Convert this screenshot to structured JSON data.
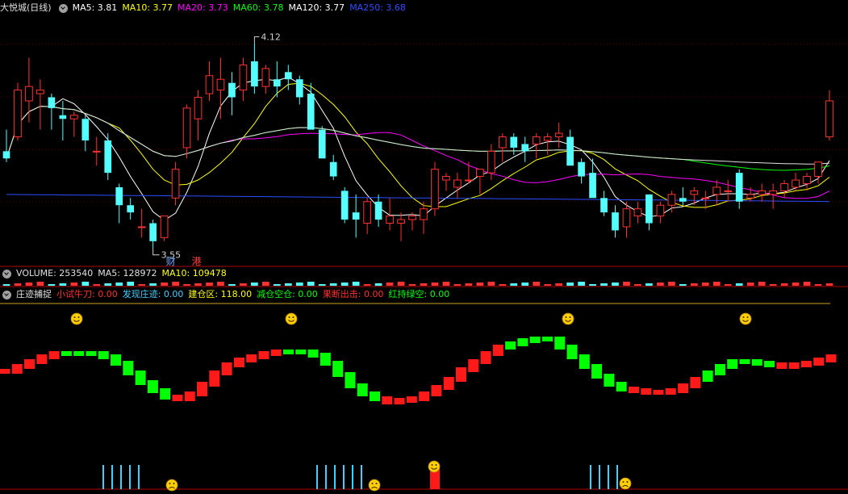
{
  "title_bar": {
    "stock_name": "大悦城(日线)",
    "ma": [
      {
        "label": "MA5: 3.81",
        "color": "#ffffff"
      },
      {
        "label": "MA10: 3.77",
        "color": "#ffff00"
      },
      {
        "label": "MA20: 3.73",
        "color": "#ff00ff"
      },
      {
        "label": "MA60: 3.78",
        "color": "#00ff00"
      },
      {
        "label": "MA120: 3.77",
        "color": "#ffffff"
      },
      {
        "label": "MA250: 3.68",
        "color": "#2d4dff"
      }
    ]
  },
  "price_annotations": {
    "high": "4.12",
    "low": "3.55",
    "badge_cai": "财",
    "badge_gang": "港"
  },
  "volume_bar": {
    "label": "VOLUME: 253540",
    "ma5": "MA5: 128972",
    "ma10": "MA10: 109478"
  },
  "indicator_bar": {
    "name": "庄迹捕捉",
    "items": [
      {
        "label": "小试牛刀: 0.00",
        "color": "#ff3030"
      },
      {
        "label": "发现庄迹: 0.00",
        "color": "#40d0ff"
      },
      {
        "label": "建仓区: 118.00",
        "color": "#ffff00"
      },
      {
        "label": "减仓空仓: 0.00",
        "color": "#00ff00"
      },
      {
        "label": "果断出击: 0.00",
        "color": "#ff3030"
      },
      {
        "label": "红持绿空: 0.00",
        "color": "#00ff00"
      }
    ]
  },
  "chart_data": {
    "type": "candlestick",
    "price_range": [
      3.5,
      4.2
    ],
    "candles": [
      {
        "o": 3.82,
        "h": 3.88,
        "l": 3.79,
        "c": 3.8
      },
      {
        "o": 3.86,
        "h": 4.01,
        "l": 3.85,
        "c": 3.99
      },
      {
        "o": 3.96,
        "h": 4.08,
        "l": 3.9,
        "c": 4.0
      },
      {
        "o": 3.98,
        "h": 4.02,
        "l": 3.88,
        "c": 3.99
      },
      {
        "o": 3.97,
        "h": 3.98,
        "l": 3.88,
        "c": 3.94
      },
      {
        "o": 3.92,
        "h": 3.96,
        "l": 3.85,
        "c": 3.91
      },
      {
        "o": 3.91,
        "h": 3.93,
        "l": 3.86,
        "c": 3.92
      },
      {
        "o": 3.91,
        "h": 3.92,
        "l": 3.82,
        "c": 3.85
      },
      {
        "o": 3.82,
        "h": 3.86,
        "l": 3.78,
        "c": 3.82
      },
      {
        "o": 3.85,
        "h": 3.87,
        "l": 3.74,
        "c": 3.76
      },
      {
        "o": 3.72,
        "h": 3.73,
        "l": 3.62,
        "c": 3.67
      },
      {
        "o": 3.67,
        "h": 3.69,
        "l": 3.63,
        "c": 3.65
      },
      {
        "o": 3.61,
        "h": 3.66,
        "l": 3.58,
        "c": 3.61
      },
      {
        "o": 3.62,
        "h": 3.63,
        "l": 3.55,
        "c": 3.57
      },
      {
        "o": 3.58,
        "h": 3.64,
        "l": 3.57,
        "c": 3.64
      },
      {
        "o": 3.69,
        "h": 3.79,
        "l": 3.67,
        "c": 3.77
      },
      {
        "o": 3.83,
        "h": 3.95,
        "l": 3.8,
        "c": 3.94
      },
      {
        "o": 3.91,
        "h": 3.99,
        "l": 3.85,
        "c": 3.97
      },
      {
        "o": 3.98,
        "h": 4.07,
        "l": 3.96,
        "c": 4.03
      },
      {
        "o": 3.99,
        "h": 4.08,
        "l": 3.91,
        "c": 4.02
      },
      {
        "o": 4.01,
        "h": 4.04,
        "l": 3.92,
        "c": 3.97
      },
      {
        "o": 3.99,
        "h": 4.08,
        "l": 3.96,
        "c": 4.06
      },
      {
        "o": 4.07,
        "h": 4.12,
        "l": 3.98,
        "c": 4.0
      },
      {
        "o": 4.0,
        "h": 4.06,
        "l": 3.98,
        "c": 4.05
      },
      {
        "o": 4.02,
        "h": 4.07,
        "l": 3.97,
        "c": 4.0
      },
      {
        "o": 4.04,
        "h": 4.06,
        "l": 3.99,
        "c": 4.02
      },
      {
        "o": 4.02,
        "h": 4.03,
        "l": 3.95,
        "c": 3.97
      },
      {
        "o": 3.98,
        "h": 4.01,
        "l": 3.91,
        "c": 3.88
      },
      {
        "o": 3.88,
        "h": 3.89,
        "l": 3.8,
        "c": 3.8
      },
      {
        "o": 3.79,
        "h": 3.81,
        "l": 3.74,
        "c": 3.75
      },
      {
        "o": 3.71,
        "h": 3.72,
        "l": 3.62,
        "c": 3.63
      },
      {
        "o": 3.65,
        "h": 3.7,
        "l": 3.58,
        "c": 3.63
      },
      {
        "o": 3.62,
        "h": 3.69,
        "l": 3.59,
        "c": 3.68
      },
      {
        "o": 3.68,
        "h": 3.7,
        "l": 3.61,
        "c": 3.63
      },
      {
        "o": 3.62,
        "h": 3.69,
        "l": 3.6,
        "c": 3.64
      },
      {
        "o": 3.62,
        "h": 3.65,
        "l": 3.57,
        "c": 3.63
      },
      {
        "o": 3.63,
        "h": 3.65,
        "l": 3.6,
        "c": 3.64
      },
      {
        "o": 3.63,
        "h": 3.68,
        "l": 3.59,
        "c": 3.66
      },
      {
        "o": 3.66,
        "h": 3.79,
        "l": 3.64,
        "c": 3.77
      },
      {
        "o": 3.74,
        "h": 3.76,
        "l": 3.71,
        "c": 3.75
      },
      {
        "o": 3.72,
        "h": 3.76,
        "l": 3.69,
        "c": 3.74
      },
      {
        "o": 3.74,
        "h": 3.79,
        "l": 3.73,
        "c": 3.74
      },
      {
        "o": 3.75,
        "h": 3.77,
        "l": 3.7,
        "c": 3.77
      },
      {
        "o": 3.76,
        "h": 3.84,
        "l": 3.74,
        "c": 3.82
      },
      {
        "o": 3.83,
        "h": 3.87,
        "l": 3.79,
        "c": 3.86
      },
      {
        "o": 3.86,
        "h": 3.87,
        "l": 3.81,
        "c": 3.83
      },
      {
        "o": 3.84,
        "h": 3.86,
        "l": 3.79,
        "c": 3.82
      },
      {
        "o": 3.84,
        "h": 3.87,
        "l": 3.8,
        "c": 3.86
      },
      {
        "o": 3.85,
        "h": 3.87,
        "l": 3.81,
        "c": 3.86
      },
      {
        "o": 3.86,
        "h": 3.9,
        "l": 3.83,
        "c": 3.87
      },
      {
        "o": 3.86,
        "h": 3.88,
        "l": 3.8,
        "c": 3.78
      },
      {
        "o": 3.79,
        "h": 3.8,
        "l": 3.73,
        "c": 3.75
      },
      {
        "o": 3.76,
        "h": 3.8,
        "l": 3.7,
        "c": 3.69
      },
      {
        "o": 3.69,
        "h": 3.71,
        "l": 3.64,
        "c": 3.65
      },
      {
        "o": 3.65,
        "h": 3.67,
        "l": 3.58,
        "c": 3.6
      },
      {
        "o": 3.61,
        "h": 3.68,
        "l": 3.58,
        "c": 3.66
      },
      {
        "o": 3.64,
        "h": 3.68,
        "l": 3.62,
        "c": 3.66
      },
      {
        "o": 3.7,
        "h": 3.7,
        "l": 3.6,
        "c": 3.62
      },
      {
        "o": 3.64,
        "h": 3.68,
        "l": 3.62,
        "c": 3.67
      },
      {
        "o": 3.67,
        "h": 3.71,
        "l": 3.65,
        "c": 3.7
      },
      {
        "o": 3.69,
        "h": 3.72,
        "l": 3.67,
        "c": 3.68
      },
      {
        "o": 3.7,
        "h": 3.72,
        "l": 3.67,
        "c": 3.71
      },
      {
        "o": 3.69,
        "h": 3.71,
        "l": 3.66,
        "c": 3.69
      },
      {
        "o": 3.7,
        "h": 3.74,
        "l": 3.67,
        "c": 3.72
      },
      {
        "o": 3.71,
        "h": 3.74,
        "l": 3.68,
        "c": 3.71
      },
      {
        "o": 3.76,
        "h": 3.77,
        "l": 3.66,
        "c": 3.68
      },
      {
        "o": 3.69,
        "h": 3.72,
        "l": 3.68,
        "c": 3.7
      },
      {
        "o": 3.7,
        "h": 3.73,
        "l": 3.68,
        "c": 3.71
      },
      {
        "o": 3.7,
        "h": 3.73,
        "l": 3.66,
        "c": 3.71
      },
      {
        "o": 3.71,
        "h": 3.74,
        "l": 3.69,
        "c": 3.73
      },
      {
        "o": 3.72,
        "h": 3.76,
        "l": 3.71,
        "c": 3.74
      },
      {
        "o": 3.73,
        "h": 3.76,
        "l": 3.71,
        "c": 3.75
      },
      {
        "o": 3.75,
        "h": 3.79,
        "l": 3.73,
        "c": 3.79
      },
      {
        "o": 3.86,
        "h": 3.99,
        "l": 3.85,
        "c": 3.96
      }
    ],
    "indicator": {
      "values": [
        20,
        23,
        26,
        29,
        31,
        31,
        31,
        31,
        29,
        25,
        19,
        13,
        8,
        4,
        3,
        6,
        12,
        19,
        24,
        27,
        29,
        31,
        32,
        32,
        32,
        30,
        25,
        18,
        11,
        6,
        3,
        1,
        2,
        3,
        6,
        10,
        15,
        21,
        26,
        31,
        35,
        37,
        39,
        40,
        40,
        35,
        29,
        23,
        17,
        12,
        9,
        8,
        7,
        7,
        8,
        11,
        15,
        19,
        23,
        26,
        26,
        25,
        24,
        23,
        24,
        25,
        27,
        29
      ],
      "colors": "rrrrrggg ggggggrrrrrrrrrgggggggg rrrrrrrrrrgggggggggg rrrrrrgggg ggrrr"
    }
  }
}
